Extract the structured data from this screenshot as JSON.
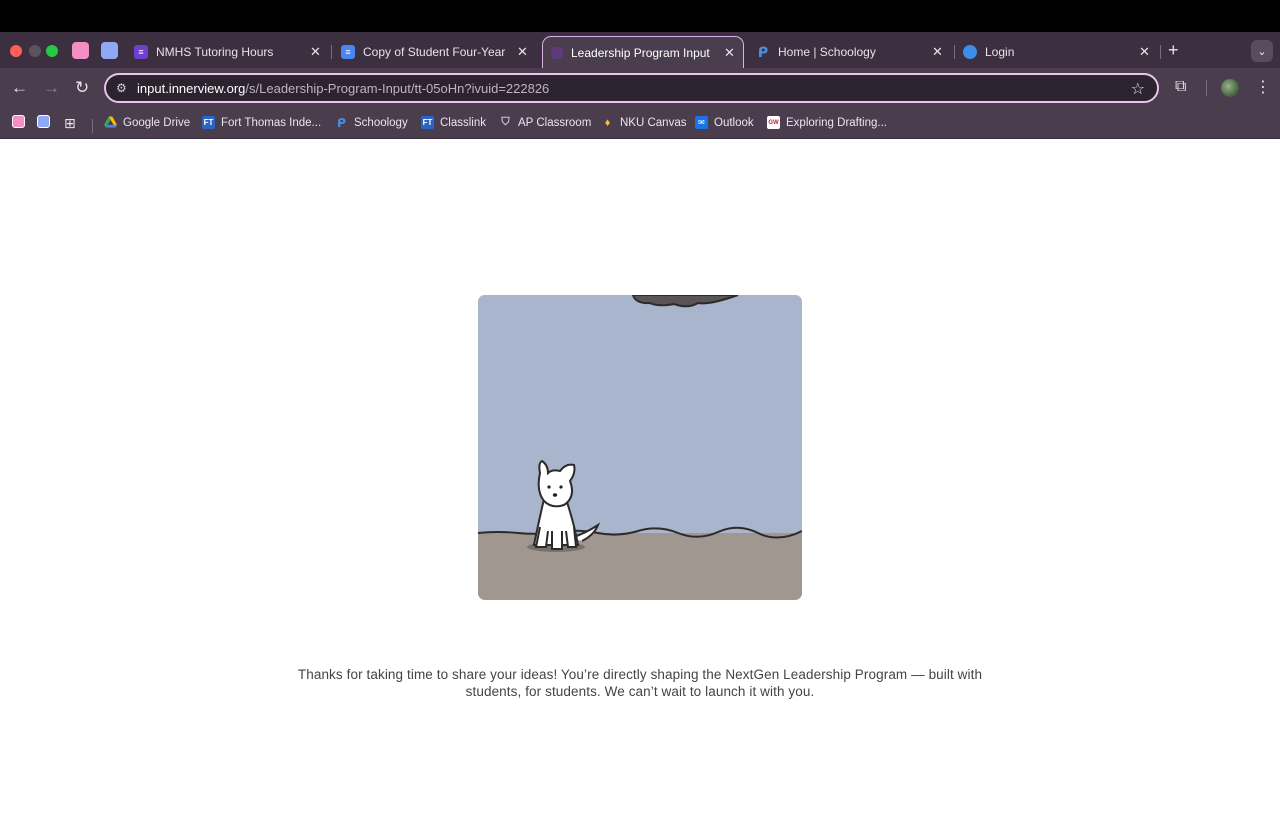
{
  "browser": {
    "tabs": [
      {
        "title": "NMHS Tutoring Hours",
        "icon": "google-forms-icon",
        "color": "#6f3fd1"
      },
      {
        "title": "Copy of Student Four-Year Pl",
        "icon": "google-docs-icon",
        "color": "#4a86f0"
      },
      {
        "title": "Leadership Program Input",
        "icon": "innerview-icon",
        "color": "#5d3a7a"
      },
      {
        "title": "Home | Schoology",
        "icon": "schoology-icon",
        "color": "#4c8fe0"
      },
      {
        "title": "Login",
        "icon": "classlink-icon",
        "color": "#3d8ee8"
      }
    ],
    "close_glyph": "✕",
    "new_tab_glyph": "+",
    "address": {
      "host": "input.innerview.org",
      "path": "/s/Leadership-Program-Input/tt-05oHn?ivuid=222826"
    },
    "bookmarks": [
      {
        "label": "Google Drive",
        "icon": "google-drive-icon"
      },
      {
        "label": "Fort Thomas Inde...",
        "icon": "ft-icon",
        "badge": "FT"
      },
      {
        "label": "Schoology",
        "icon": "schoology-icon"
      },
      {
        "label": "Classlink",
        "icon": "ft-icon",
        "badge": "FT"
      },
      {
        "label": "AP Classroom",
        "icon": "ap-shield-icon"
      },
      {
        "label": "NKU Canvas",
        "icon": "nku-flame-icon"
      },
      {
        "label": "Outlook",
        "icon": "outlook-icon"
      },
      {
        "label": "Exploring Drafting...",
        "icon": "gw-icon",
        "badge": "GW"
      }
    ]
  },
  "page": {
    "message_line1": "Thanks for taking  time to share your ideas! You’re directly shaping the NextGen Leadership Program — built with",
    "message_line2": "students, for students. We can’t wait to launch it with you."
  }
}
